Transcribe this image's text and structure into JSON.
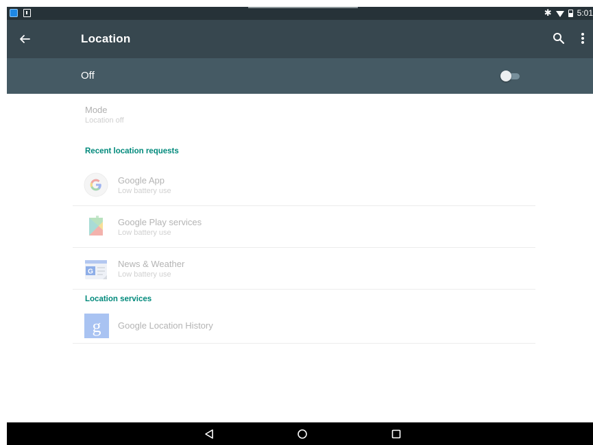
{
  "status_bar": {
    "time": "5:01",
    "icons": [
      "app-notification-icon",
      "download-icon",
      "bluetooth-icon",
      "wifi-icon",
      "battery-icon"
    ]
  },
  "toolbar": {
    "title": "Location",
    "back_icon": "arrow-left-icon",
    "search_icon": "search-icon",
    "more_icon": "more-vert-icon"
  },
  "master_switch": {
    "label": "Off",
    "checked": false
  },
  "mode": {
    "title": "Mode",
    "summary": "Location off"
  },
  "recent_requests": {
    "header": "Recent location requests",
    "items": [
      {
        "title": "Google App",
        "summary": "Low battery use",
        "icon": "google-g-icon"
      },
      {
        "title": "Google Play services",
        "summary": "Low battery use",
        "icon": "play-services-icon"
      },
      {
        "title": "News & Weather",
        "summary": "Low battery use",
        "icon": "news-weather-icon"
      }
    ]
  },
  "location_services": {
    "header": "Location services",
    "items": [
      {
        "title": "Google Location History",
        "icon": "google-settings-icon"
      }
    ]
  },
  "colors": {
    "status_bar": "#263238",
    "toolbar": "#37474f",
    "switch_bar": "#455a64",
    "accent": "#00897b"
  },
  "nav_bar": {
    "buttons": [
      "back-nav-icon",
      "home-nav-icon",
      "recents-nav-icon"
    ]
  }
}
